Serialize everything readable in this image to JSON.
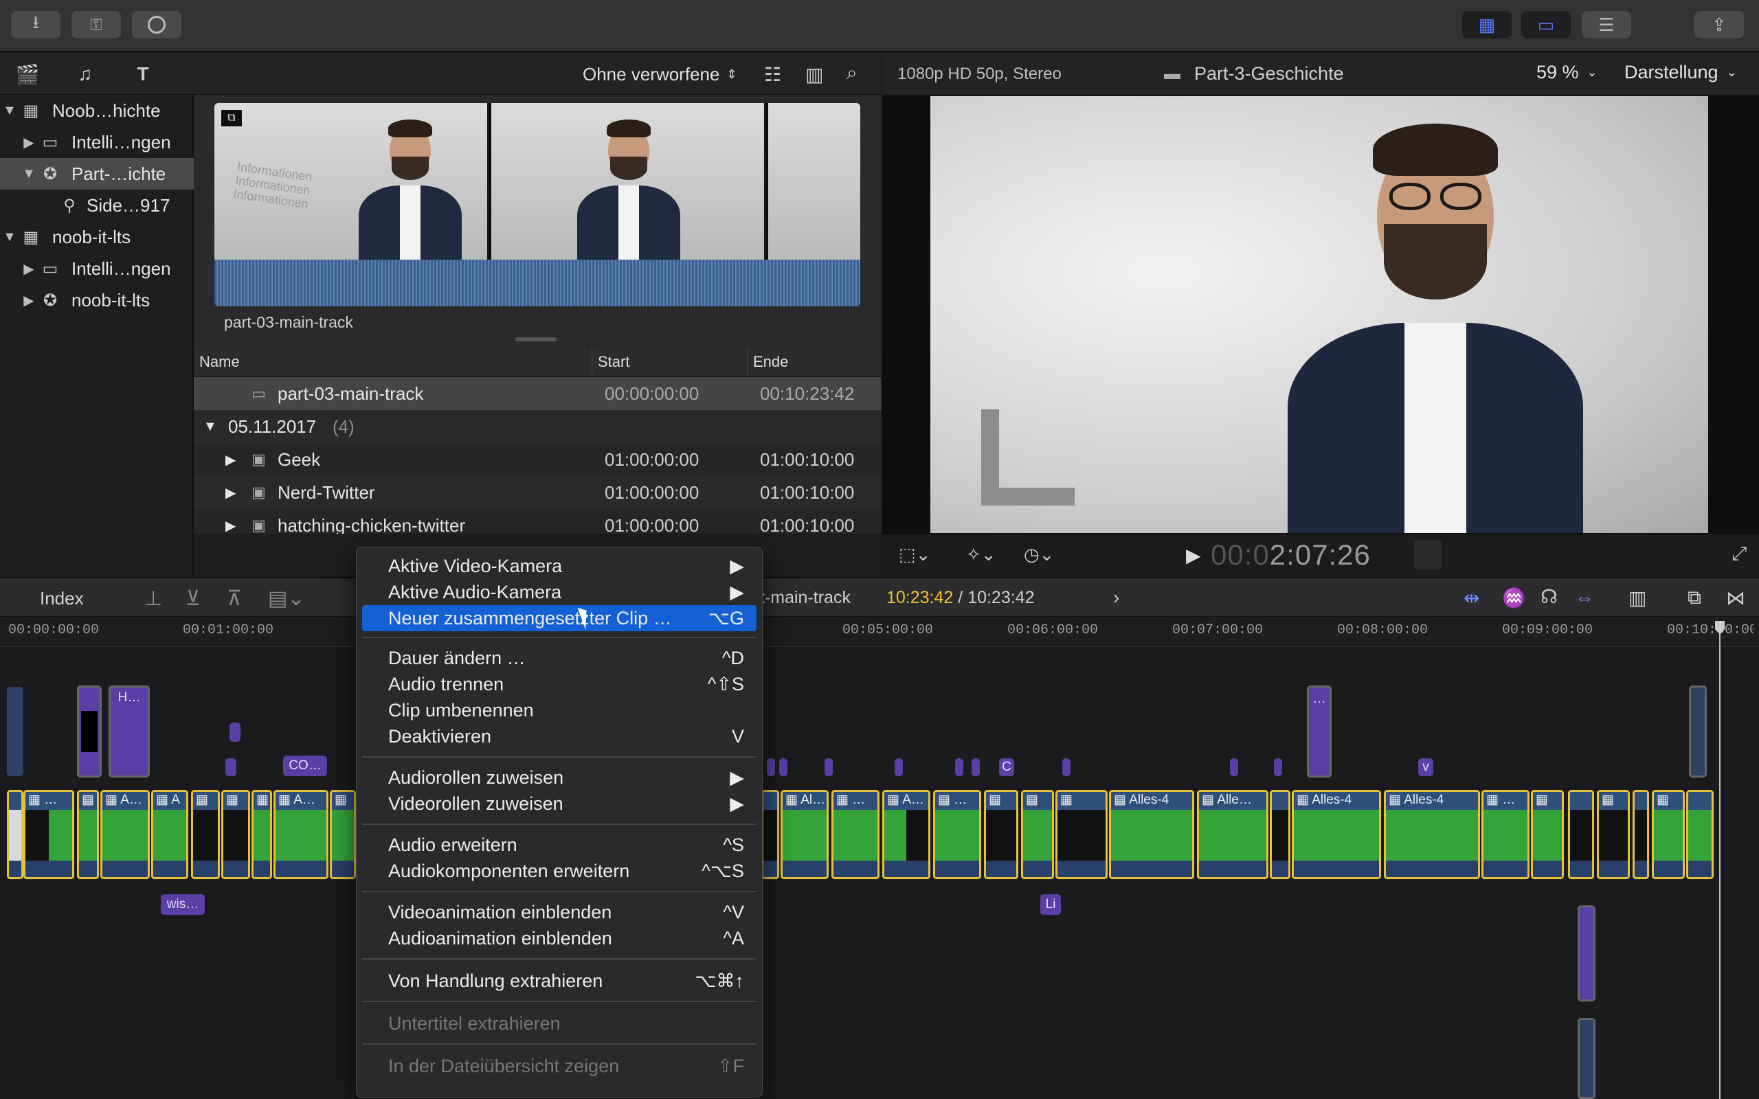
{
  "toolbar": {
    "import_icon": "download-arrow-icon",
    "keyword_icon": "key-icon",
    "bg_icon": "circle-icon"
  },
  "library": {
    "items": [
      {
        "label": "Noob…hichte",
        "type": "library"
      },
      {
        "label": "Intelli…ngen",
        "type": "folder"
      },
      {
        "label": "Part-…ichte",
        "type": "event"
      },
      {
        "label": "Side…917",
        "type": "clip"
      },
      {
        "label": "noob-it-lts",
        "type": "library"
      },
      {
        "label": "Intelli…ngen",
        "type": "folder"
      },
      {
        "label": "noob-it-lts",
        "type": "event"
      }
    ]
  },
  "browser": {
    "filter": "Ohne verworfene",
    "filmstrip_label": "part-03-main-track",
    "columns": [
      "Name",
      "Start",
      "Ende"
    ],
    "rows": [
      {
        "name": "part-03-main-track",
        "start": "00:00:00:00",
        "end": "00:10:23:42"
      },
      {
        "name": "05.11.2017",
        "count": "(4)"
      },
      {
        "name": "Geek",
        "start": "01:00:00:00",
        "end": "01:00:10:00"
      },
      {
        "name": "Nerd-Twitter",
        "start": "01:00:00:00",
        "end": "01:00:10:00"
      },
      {
        "name": "hatching-chicken-twitter",
        "start": "01:00:00:00",
        "end": "01:00:10:00"
      }
    ]
  },
  "viewer": {
    "format": "1080p HD 50p, Stereo",
    "title": "Part-3-Geschichte",
    "zoom": "59 %",
    "view_menu": "Darstellung",
    "timecode_dim": "00:0",
    "timecode": "2:07:26"
  },
  "timeline": {
    "index_label": "Index",
    "project": "t-main-track",
    "duration_current": "10:23:42",
    "duration_sep": " / ",
    "duration_total": "10:23:42",
    "ruler": [
      "00:00:00:00",
      "00:01:00:00",
      "00:05:00:00",
      "00:06:00:00",
      "00:07:00:00",
      "00:08:00:00",
      "00:09:00:00",
      "00:10:00:00"
    ],
    "clips": [
      "A…",
      "A",
      "A…",
      "Al…",
      "…",
      "A…",
      "…",
      "Alles-4",
      "Alle…",
      "Alles-4",
      "Alles-4",
      "…"
    ],
    "connected": [
      "H…",
      "CO…",
      "wis…",
      "Li",
      "…",
      "v",
      "C"
    ]
  },
  "menu": {
    "items": [
      {
        "label": "Aktive Video-Kamera",
        "shortcut": "▶"
      },
      {
        "label": "Aktive Audio-Kamera",
        "shortcut": "▶"
      },
      {
        "label": "Neuer zusammengesetzter Clip …",
        "shortcut": "⌥G"
      },
      {
        "label": "Dauer ändern …",
        "shortcut": "^D"
      },
      {
        "label": "Audio trennen",
        "shortcut": "^⇧S"
      },
      {
        "label": "Clip umbenennen",
        "shortcut": ""
      },
      {
        "label": "Deaktivieren",
        "shortcut": "V"
      },
      {
        "label": "Audiorollen zuweisen",
        "shortcut": "▶"
      },
      {
        "label": "Videorollen zuweisen",
        "shortcut": "▶"
      },
      {
        "label": "Audio erweitern",
        "shortcut": "^S"
      },
      {
        "label": "Audiokomponenten erweitern",
        "shortcut": "^⌥S"
      },
      {
        "label": "Videoanimation einblenden",
        "shortcut": "^V"
      },
      {
        "label": "Audioanimation einblenden",
        "shortcut": "^A"
      },
      {
        "label": "Von Handlung extrahieren",
        "shortcut": "⌥⌘↑"
      },
      {
        "label": "Untertitel extrahieren",
        "shortcut": ""
      },
      {
        "label": "In der Dateiübersicht zeigen",
        "shortcut": "⇧F"
      }
    ]
  },
  "colors": {
    "accent": "#1560d4",
    "clip_border": "#e6c23a",
    "connected": "#5a3fa4",
    "timecode": "#f2c230"
  }
}
